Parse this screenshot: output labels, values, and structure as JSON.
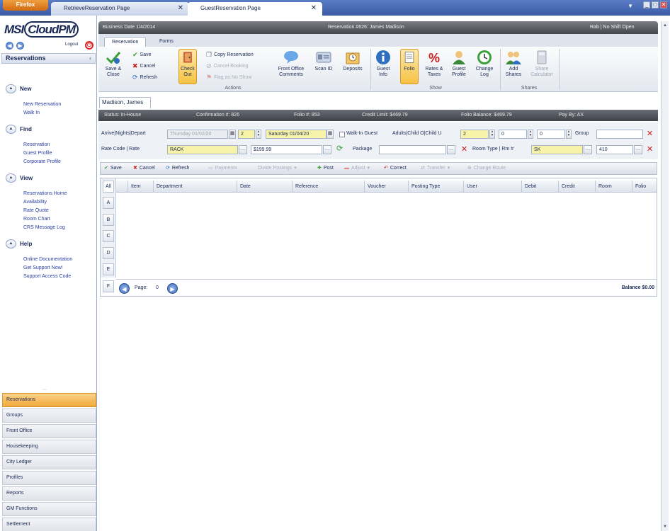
{
  "browser": {
    "menu_label": "Firefox",
    "tabs": [
      {
        "label": "RetrieveReservation Page",
        "close": "✕"
      },
      {
        "label": "GuestReservation Page",
        "close": "✕"
      }
    ],
    "win_min": "_",
    "win_max": "□",
    "win_close": "✕"
  },
  "sidebar": {
    "logo_prefix": "MSI",
    "logo_main": "CloudPM",
    "logout_label": "Logout",
    "header": "Reservations",
    "header_chevron": "‹",
    "sections": [
      {
        "title": "New",
        "links": [
          "New Reservation",
          "Walk In"
        ]
      },
      {
        "title": "Find",
        "links": [
          "Reservation",
          "Guest Profile",
          "Corporate Profile"
        ]
      },
      {
        "title": "View",
        "links": [
          "Reservations Home",
          "Availability",
          "Rate Quote",
          "Room Chart",
          "CRS Message Log"
        ]
      },
      {
        "title": "Help",
        "links": [
          "Online Documentation",
          "Get Support Now!",
          "Support Access Code"
        ]
      }
    ],
    "bottom_nav": [
      "Reservations",
      "Groups",
      "Front Office",
      "Housekeeping",
      "City Ledger",
      "Profiles",
      "Reports",
      "GM Functions",
      "Settlement"
    ],
    "active_nav": "Reservations"
  },
  "header": {
    "business_date": "Business Date  1/4/2014",
    "reservation": "Reservation #626: James Madison",
    "user": "Rab  |  No Shift Open"
  },
  "ribbon": {
    "tabs": [
      "Reservation",
      "Forms"
    ],
    "active_tab": "Reservation",
    "save_close": "Save & Close",
    "save": "Save",
    "cancel": "Cancel",
    "refresh": "Refresh",
    "check_out": "Check Out",
    "copy_reservation": "Copy Reservation",
    "cancel_booking": "Cancel Booking",
    "flag_no_show": "Flag as No Show",
    "front_office_comments": "Front Office Comments",
    "scan_id": "Scan ID",
    "deposits": "Deposits",
    "actions_group": "Actions",
    "guest_info": "Guest Info",
    "folio": "Folio",
    "rates_taxes": "Rates & Taxes",
    "guest_profile": "Guest Profile",
    "change_log": "Change Log",
    "show_group": "Show",
    "add_shares": "Add Shares",
    "share_calculator": "Share Calculator",
    "shares_group": "Shares"
  },
  "guest_tab": "Madison, James",
  "status": {
    "status": "Status: In-House",
    "confirmation": "Confirmation #: 826",
    "folio": "Folio #: 853",
    "credit_limit": "Credit Limit: $469.79",
    "folio_balance": "Folio Balance: $469.79",
    "pay_by": "Pay By: AX"
  },
  "form": {
    "arrive_label": "Arrive|Nights|Depart",
    "arrive_value": "Thursday 01/02/20",
    "nights_value": "2",
    "depart_value": "Saturday 01/04/20",
    "walkin_label": "Walk-In Guest",
    "adults_label": "Adults|Child O|Child U",
    "adults_value": "2",
    "child_o_value": "0",
    "child_u_value": "0",
    "group_label": "Group",
    "group_value": "",
    "rate_label": "Rate Code | Rate",
    "rate_code": "RACK",
    "rate_value": "$199.99",
    "package_label": "Package",
    "package_value": "",
    "room_label": "Room Type | Rm #",
    "room_type": "SK",
    "room_no": "410"
  },
  "grid_toolbar": {
    "save": "Save",
    "cancel": "Cancel",
    "refresh": "Refresh",
    "payments": "Payments",
    "divide_postings": "Divide Postings",
    "post": "Post",
    "adjust": "Adjust",
    "correct": "Correct",
    "transfer": "Transfer",
    "change_route": "Change Route"
  },
  "grid": {
    "alpha": [
      "All",
      "A",
      "B",
      "C",
      "D",
      "E",
      "F"
    ],
    "columns": [
      "Item",
      "Department",
      "Date",
      "Reference",
      "Voucher",
      "Posting Type",
      "User",
      "Debit",
      "Credit",
      "Room",
      "Folio"
    ],
    "page_label": "Page:",
    "page_value": "0",
    "balance": "Balance $0.00"
  }
}
